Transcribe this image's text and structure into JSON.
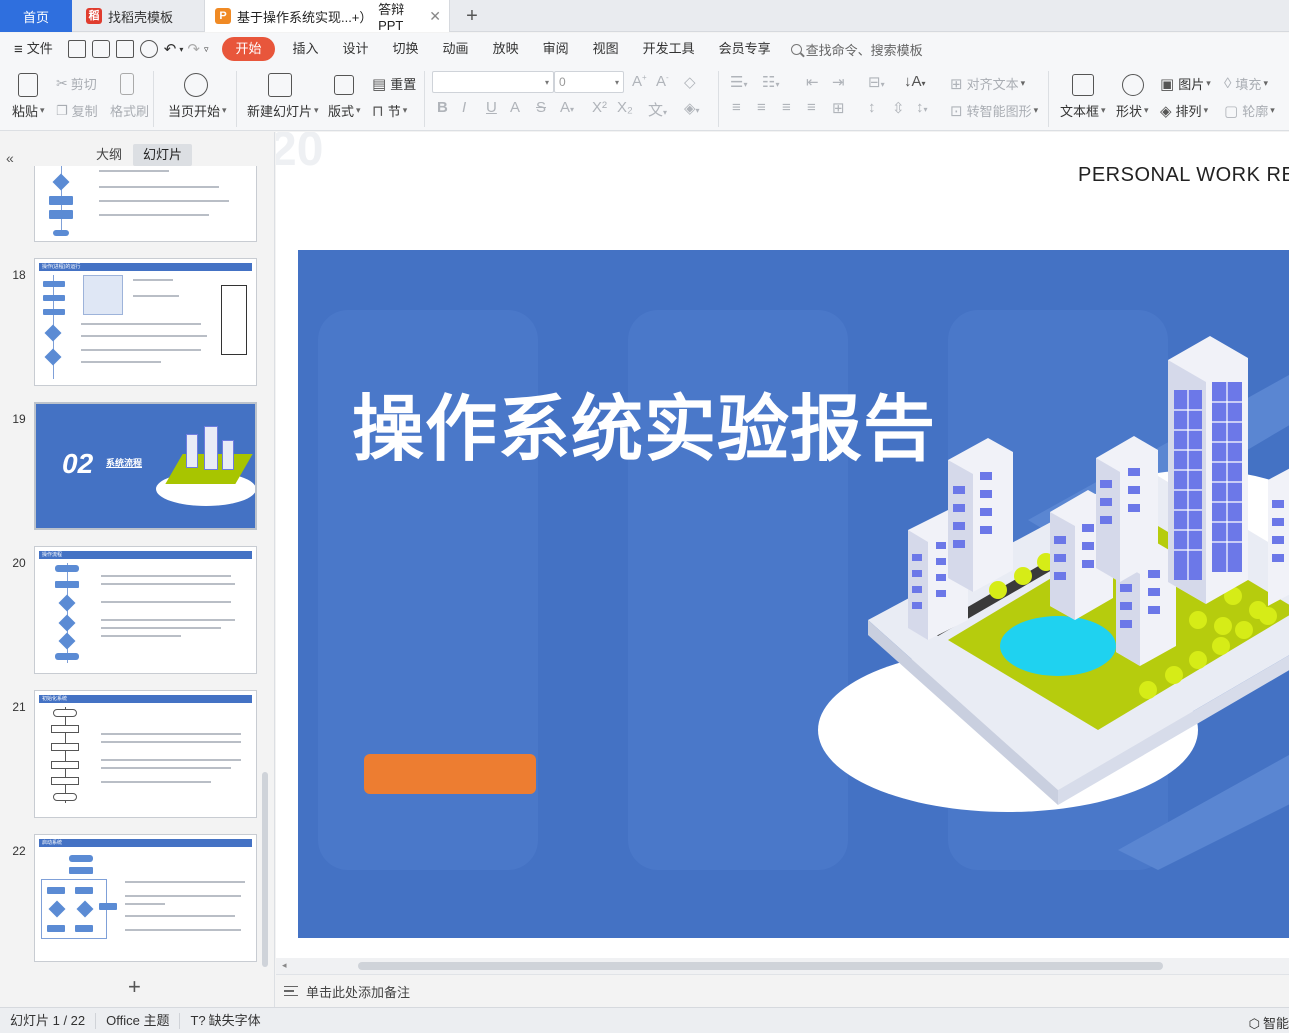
{
  "tabs": {
    "home": "首页",
    "template": "找稻壳模板",
    "doc": "基于操作系统实现...+）答辩PPT",
    "doc_short": "基于操作系统实现...+）",
    "doc_suffix": "答辩PPT"
  },
  "menu": {
    "file": "文件",
    "items": [
      "开始",
      "插入",
      "设计",
      "切换",
      "动画",
      "放映",
      "审阅",
      "视图",
      "开发工具",
      "会员专享"
    ],
    "search_placeholder": "查找命令、搜索模板"
  },
  "ribbon": {
    "paste": "粘贴",
    "cut": "剪切",
    "copy": "复制",
    "format_painter": "格式刷",
    "from_current": "当页开始",
    "new_slide": "新建幻灯片",
    "layout": "版式",
    "reset": "重置",
    "section": "节",
    "font_size": "0",
    "align_text": "对齐文本",
    "smart_shape": "转智能图形",
    "textbox": "文本框",
    "shape": "形状",
    "picture": "图片",
    "arrange": "排列",
    "fill": "填充",
    "outline": "轮廓"
  },
  "panel": {
    "outline_tab": "大纲",
    "slides_tab": "幻灯片",
    "thumbnails": [
      {
        "num": "18",
        "title": "操作(进程)的运行"
      },
      {
        "num": "19",
        "title": "02 系统流程"
      },
      {
        "num": "20",
        "title": "操作流程"
      },
      {
        "num": "21",
        "title": "初始化系统"
      },
      {
        "num": "22",
        "title": "启动系统"
      }
    ],
    "thumb19_big": "02",
    "thumb19_label": "系统流程"
  },
  "slide": {
    "header_text": "PERSONAL WORK RE",
    "title": "操作系统实验报告",
    "faint_bg": "20"
  },
  "notes": {
    "placeholder": "单击此处添加备注"
  },
  "status": {
    "slide_counter": "幻灯片 1 / 22",
    "theme": "Office 主题",
    "missing_font": "缺失字体",
    "smart": "智能"
  },
  "colors": {
    "accent": "#2f6fde",
    "start_tab": "#e8563b",
    "slide_bg": "#4472c4",
    "slide_button": "#ed7d31"
  }
}
